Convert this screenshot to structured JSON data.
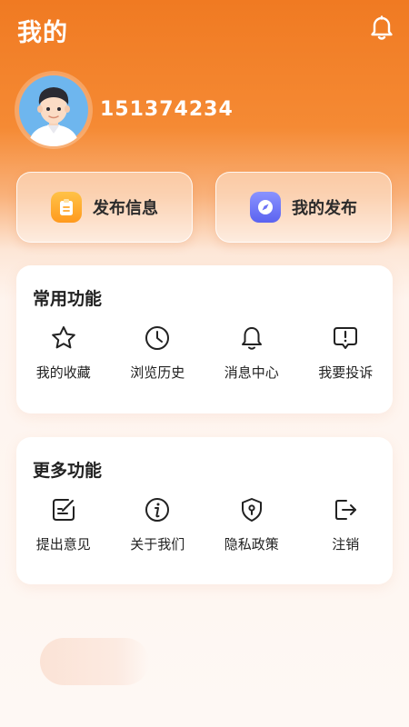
{
  "header": {
    "title": "我的",
    "bell_icon": "bell-icon"
  },
  "profile": {
    "username": "151374234",
    "avatar_icon": "user-avatar"
  },
  "actions": [
    {
      "label": "发布信息",
      "icon": "clipboard-icon",
      "color": "#FFA62B"
    },
    {
      "label": "我的发布",
      "icon": "compass-icon",
      "color": "#6C72F5"
    }
  ],
  "common": {
    "title": "常用功能",
    "items": [
      {
        "label": "我的收藏",
        "icon": "star-icon"
      },
      {
        "label": "浏览历史",
        "icon": "clock-icon"
      },
      {
        "label": "消息中心",
        "icon": "bell-icon"
      },
      {
        "label": "我要投诉",
        "icon": "report-icon"
      }
    ]
  },
  "more": {
    "title": "更多功能",
    "items": [
      {
        "label": "提出意见",
        "icon": "edit-icon"
      },
      {
        "label": "关于我们",
        "icon": "info-icon"
      },
      {
        "label": "隐私政策",
        "icon": "shield-icon"
      },
      {
        "label": "注销",
        "icon": "logout-icon"
      }
    ]
  },
  "colors": {
    "brand": "#F07A22",
    "text": "#222222",
    "card": "#FFFFFF"
  }
}
